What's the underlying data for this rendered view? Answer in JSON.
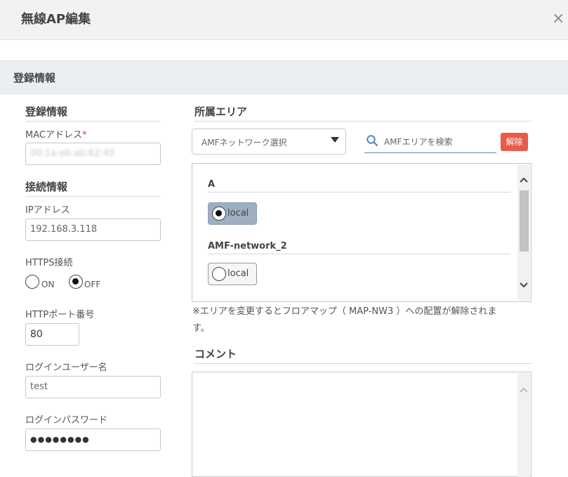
{
  "window": {
    "title": "無線AP編集",
    "close_symbol": "×"
  },
  "section": {
    "title": "登録情報"
  },
  "left": {
    "registration_title": "登録情報",
    "mac_label": "MACアドレス",
    "mac_required": "*",
    "mac_value": "00:1a:eb:ab:62:40",
    "connection_title": "接続情報",
    "ip_label": "IPアドレス",
    "ip_value": "192.168.3.118",
    "https_label": "HTTPS接続",
    "https_on_label": "ON",
    "https_off_label": "OFF",
    "https_selected": "OFF",
    "http_port_label": "HTTPポート番号",
    "http_port_value": "80",
    "login_user_label": "ログインユーザー名",
    "login_user_value": "test",
    "login_password_label": "ログインパスワード",
    "login_password_value": "●●●●●●●●"
  },
  "right": {
    "area_title": "所属エリア",
    "network_select_value": "AMFネットワーク選択",
    "search_placeholder": "AMFエリアを検索",
    "clear_label": "解除",
    "areas": [
      {
        "network": "A",
        "area": "local",
        "selected": true
      },
      {
        "network": "AMF-network_2",
        "area": "local",
        "selected": false
      }
    ],
    "notice_line1": "※エリアを変更するとフロアマップ（ MAP-NW3 ）への配置が解除されま",
    "notice_line2": "す。",
    "comment_title": "コメント",
    "comment_value": ""
  },
  "icons": {
    "close": "close-icon",
    "search": "search-icon",
    "dropdown": "triangle-down-icon",
    "scroll_up": "chevron-up-icon",
    "scroll_down": "chevron-down-icon"
  },
  "colors": {
    "clear_button": "#e85b4a",
    "selected_area": "#9dafc0",
    "search_underline": "#5a8fc1",
    "required_mark": "#e0403a"
  }
}
